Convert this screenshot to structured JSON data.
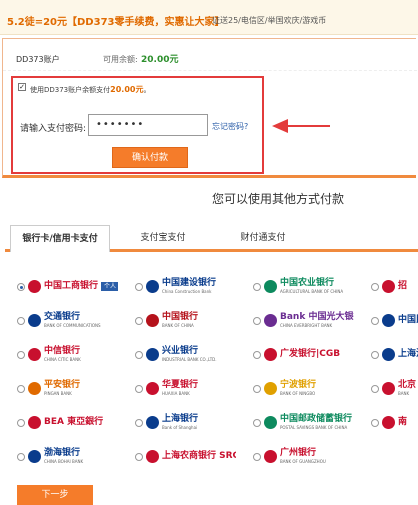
{
  "banner": {
    "promo": "5.2徒=20元【DD373零手续费，实惠让大家】",
    "sub": "证送25/电信区/举国欢庆/游戏币"
  },
  "account": {
    "label": "DD373账户",
    "balance_label": "可用余额:",
    "balance_value": "20.00元"
  },
  "payment": {
    "checkbox_mark": "✓",
    "use_prefix": "使用DD373账户余额支付",
    "use_amount": "20.00元",
    "use_suffix": "。",
    "pw_label": "请输入支付密码:",
    "pw_value": "•••••••",
    "forgot": "忘记密码?",
    "confirm": "确认付款"
  },
  "other_methods": "您可以使用其他方式付款",
  "tabs": [
    "银行卡/信用卡支付",
    "支付宝支付",
    "财付通支付"
  ],
  "banks": [
    {
      "name": "中国工商银行",
      "sub": "",
      "tag": "个人",
      "color": "#c8102e",
      "icon": "icbc-icon",
      "selected": true
    },
    {
      "name": "中国建设银行",
      "sub": "China Construction Bank",
      "tag": "",
      "color": "#0a3c8c",
      "icon": "ccb-icon",
      "selected": false
    },
    {
      "name": "中国农业银行",
      "sub": "AGRICULTURAL BANK OF CHINA",
      "tag": "",
      "color": "#0d8a5e",
      "icon": "abc-icon",
      "selected": false
    },
    {
      "name": "招",
      "sub": "",
      "tag": "",
      "color": "#c8102e",
      "icon": "cmb-icon",
      "selected": false
    },
    {
      "name": "交通银行",
      "sub": "BANK OF COMMUNICATIONS",
      "tag": "",
      "color": "#0a3c8c",
      "icon": "bocom-icon",
      "selected": false
    },
    {
      "name": "中国银行",
      "sub": "BANK OF CHINA",
      "tag": "",
      "color": "#b5121b",
      "icon": "boc-icon",
      "selected": false
    },
    {
      "name": "Bank 中国光大银行",
      "sub": "CHINA EVERBRIGHT BANK",
      "tag": "",
      "color": "#6a2c91",
      "icon": "ceb-icon",
      "selected": false
    },
    {
      "name": "中国民",
      "sub": "",
      "tag": "",
      "color": "#0a3c8c",
      "icon": "cmbc-icon",
      "selected": false
    },
    {
      "name": "中信银行",
      "sub": "CHINA CITIC BANK",
      "tag": "",
      "color": "#c8102e",
      "icon": "citic-icon",
      "selected": false
    },
    {
      "name": "兴业银行",
      "sub": "INDUSTRIAL BANK CO.,LTD.",
      "tag": "",
      "color": "#0a3c8c",
      "icon": "cib-icon",
      "selected": false
    },
    {
      "name": "广发银行|CGB",
      "sub": "",
      "tag": "",
      "color": "#c8102e",
      "icon": "cgb-icon",
      "selected": false
    },
    {
      "name": "上海浦东",
      "sub": "",
      "tag": "",
      "color": "#0a3c8c",
      "icon": "spdb-icon",
      "selected": false
    },
    {
      "name": "平安银行",
      "sub": "PINGAN BANK",
      "tag": "",
      "color": "#e06a00",
      "icon": "pingan-icon",
      "selected": false
    },
    {
      "name": "华夏银行",
      "sub": "HUAXIA BANK",
      "tag": "",
      "color": "#c8102e",
      "icon": "hxb-icon",
      "selected": false
    },
    {
      "name": "宁波银行",
      "sub": "BANK OF NINGBO",
      "tag": "",
      "color": "#e0a000",
      "icon": "nbcb-icon",
      "selected": false
    },
    {
      "name": "北京",
      "sub": "BANK",
      "tag": "",
      "color": "#c8102e",
      "icon": "bob-icon",
      "selected": false
    },
    {
      "name": "BEA 東亞銀行",
      "sub": "",
      "tag": "",
      "color": "#c8102e",
      "icon": "bea-icon",
      "selected": false
    },
    {
      "name": "上海银行",
      "sub": "Bank of Shanghai",
      "tag": "",
      "color": "#0a3c8c",
      "icon": "bos-icon",
      "selected": false
    },
    {
      "name": "中国邮政储蓄银行",
      "sub": "POSTAL SAVINGS BANK OF CHINA",
      "tag": "",
      "color": "#0d8a5e",
      "icon": "psbc-icon",
      "selected": false
    },
    {
      "name": "南",
      "sub": "",
      "tag": "",
      "color": "#c8102e",
      "icon": "njcb-icon",
      "selected": false
    },
    {
      "name": "渤海银行",
      "sub": "CHINA BOHAI BANK",
      "tag": "",
      "color": "#0a3c8c",
      "icon": "cbhb-icon",
      "selected": false
    },
    {
      "name": "上海农商银行 SRCB",
      "sub": "",
      "tag": "",
      "color": "#c8102e",
      "icon": "srcb-icon",
      "selected": false
    },
    {
      "name": "广州银行",
      "sub": "BANK OF GUANGZHOU",
      "tag": "",
      "color": "#c8102e",
      "icon": "gzcb-icon",
      "selected": false
    }
  ],
  "next": "下一步"
}
